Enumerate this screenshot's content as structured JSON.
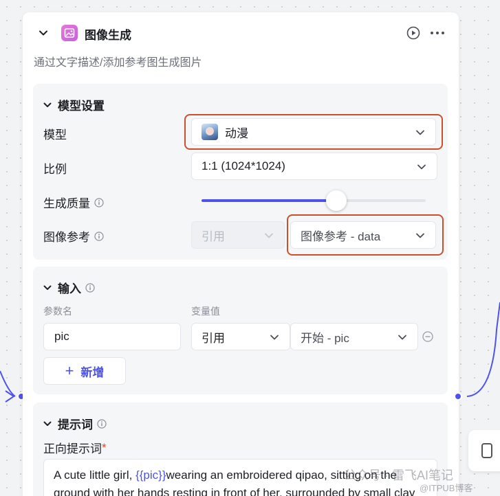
{
  "node": {
    "title": "图像生成",
    "description": "通过文字描述/添加参考图生成图片"
  },
  "model_settings": {
    "section_title": "模型设置",
    "model_label": "模型",
    "model_value": "动漫",
    "ratio_label": "比例",
    "ratio_value": "1:1 (1024*1024)",
    "quality_label": "生成质量",
    "quality_level": 0.6,
    "image_ref_label": "图像参考",
    "image_ref_mode": "引用",
    "image_ref_value": "图像参考 - data"
  },
  "input": {
    "section_title": "输入",
    "col_param_name": "参数名",
    "col_var_value": "变量值",
    "rows": [
      {
        "name": "pic",
        "mode": "引用",
        "value": "开始 - pic"
      }
    ],
    "add_label": "新增"
  },
  "prompt": {
    "section_title": "提示词",
    "positive_label": "正向提示词",
    "required_mark": "*",
    "text_before": "A cute little girl, ",
    "variable": "{{pic}}",
    "text_after": "wearing an embroidered qipao, sitting on the ground with her hands resting in front of her, surrounded by small clay"
  },
  "watermark": {
    "main": "公众号 · 雷飞AI笔记",
    "sub": "@ITPUB博客"
  },
  "colors": {
    "accent": "#4d53e8",
    "highlight": "#c9502b",
    "required": "#e4472b"
  }
}
